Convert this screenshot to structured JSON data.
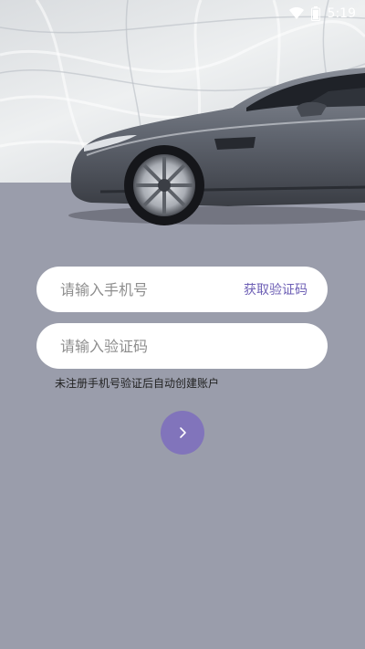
{
  "status_bar": {
    "time": "5:19",
    "icons": [
      "wifi-icon",
      "battery-icon"
    ]
  },
  "login": {
    "phone_placeholder": "请输入手机号",
    "get_code_label": "获取验证码",
    "code_placeholder": "请输入验证码",
    "hint": "未注册手机号验证后自动创建账户",
    "next_icon": "chevron-right-icon"
  },
  "colors": {
    "background": "#9a9dab",
    "accent": "#8174bb",
    "link": "#6d5fb5",
    "field_bg": "#ffffff"
  }
}
